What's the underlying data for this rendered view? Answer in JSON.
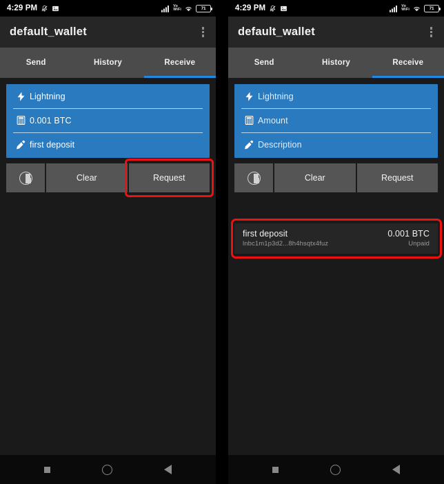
{
  "status_bar": {
    "time": "4:29 PM",
    "battery_percent": "71",
    "vo_line1": "Vo",
    "vo_line2": "WiFi",
    "icons": [
      "bell-muted-icon",
      "photo-icon",
      "signal-bars-icon",
      "volte-wifi-icon",
      "wifi-icon",
      "battery-icon"
    ]
  },
  "app_bar": {
    "title": "default_wallet",
    "overflow_icon": "overflow-menu-icon"
  },
  "tabs": [
    {
      "label": "Send",
      "active": false
    },
    {
      "label": "History",
      "active": false
    },
    {
      "label": "Receive",
      "active": true
    }
  ],
  "left_panel": {
    "form": {
      "type_field": {
        "icon": "lightning-icon",
        "value": "Lightning",
        "is_placeholder": false
      },
      "amount_field": {
        "icon": "calculator-icon",
        "value": "0.001 BTC",
        "placeholder": "Amount",
        "is_placeholder": false
      },
      "description_field": {
        "icon": "pencil-icon",
        "value": "first deposit",
        "placeholder": "Description",
        "is_placeholder": false
      }
    },
    "buttons": {
      "clock_icon": "pie-clock-icon",
      "clear_label": "Clear",
      "request_label": "Request",
      "request_highlighted": true
    }
  },
  "right_panel": {
    "form": {
      "type_field": {
        "icon": "lightning-icon",
        "value": "Lightning",
        "is_placeholder": true
      },
      "amount_field": {
        "icon": "calculator-icon",
        "value": "Amount",
        "placeholder": "Amount",
        "is_placeholder": true
      },
      "description_field": {
        "icon": "pencil-icon",
        "value": "Description",
        "placeholder": "Description",
        "is_placeholder": true
      }
    },
    "buttons": {
      "clock_icon": "pie-clock-icon",
      "clear_label": "Clear",
      "request_label": "Request",
      "request_highlighted": false
    },
    "invoice": {
      "title": "first deposit",
      "address": "lnbc1m1p3d2...8h4hsqtx4fuz",
      "amount": "0.001 BTC",
      "status": "Unpaid",
      "highlighted": true
    }
  },
  "nav_bar": {
    "recents_icon": "square-recents-icon",
    "home_icon": "circle-home-icon",
    "back_icon": "triangle-back-icon"
  },
  "colors": {
    "accent_blue": "#2a7ac0",
    "tab_indicator": "#1e88e5",
    "highlight_red": "#ee1111",
    "app_bar": "#262626",
    "tab_bar": "#4b4b4b",
    "background": "#1a1a1a",
    "button": "#555555"
  }
}
